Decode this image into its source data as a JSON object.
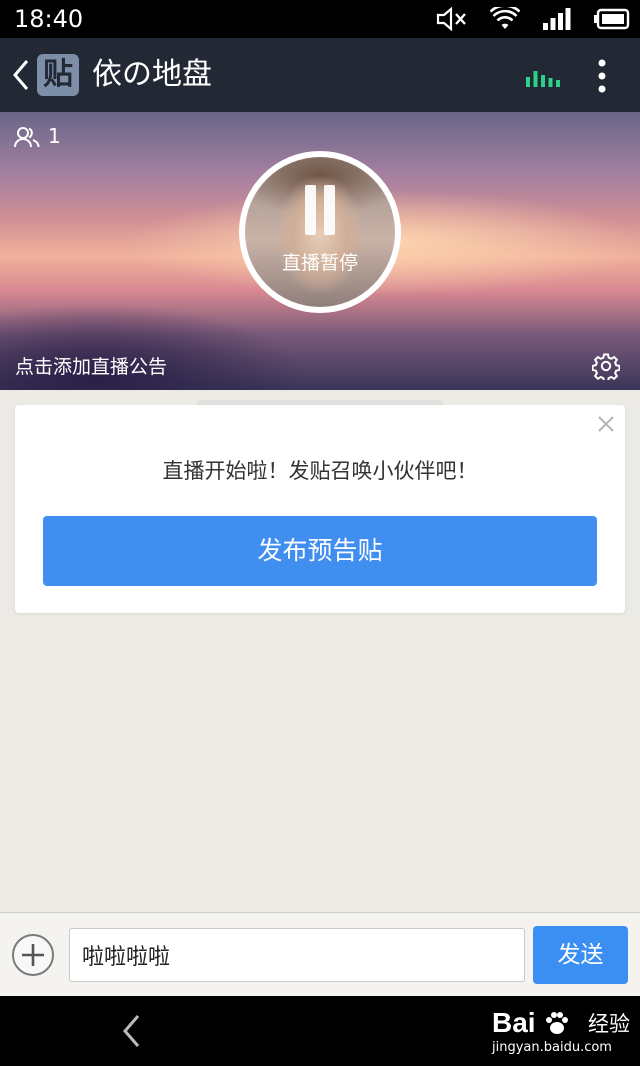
{
  "status_bar": {
    "time": "18:40",
    "icons": [
      "mute-icon",
      "wifi-icon",
      "cell-signal-icon",
      "battery-icon"
    ]
  },
  "header": {
    "logo_text": "贴",
    "title": "依の地盘",
    "icons": [
      "back-chevron-icon",
      "live-signal-icon",
      "more-icon"
    ],
    "signal_color": "#2fd08a"
  },
  "banner": {
    "audience_count": "1",
    "pause_label": "直播暂停",
    "announcement_link": "点击添加直播公告"
  },
  "card": {
    "message": "直播开始啦！发贴召唤小伙伴吧！",
    "publish_button": "发布预告贴"
  },
  "input_bar": {
    "input_value": "啦啦啦啦",
    "send_label": "发送"
  },
  "watermark": {
    "logo": "Bai",
    "logo_suffix": "经验",
    "url": "jingyan.baidu.com"
  },
  "colors": {
    "header_bg": "#222834",
    "accent_blue": "#3f8ef0",
    "background": "#eceae4"
  }
}
